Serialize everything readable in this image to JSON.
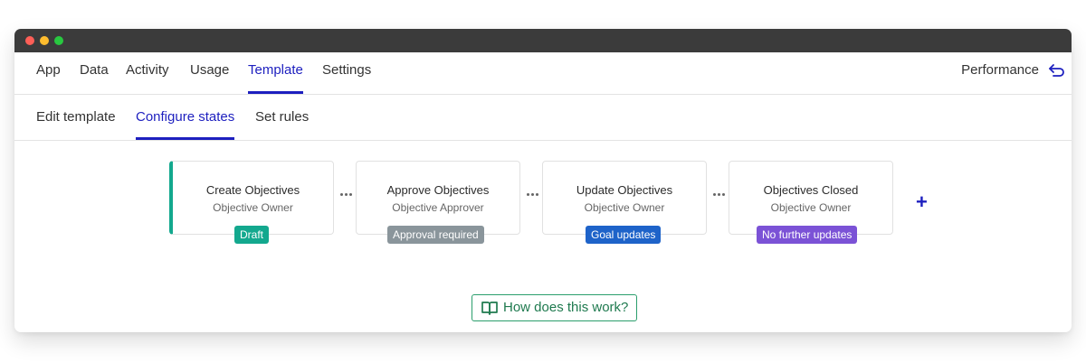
{
  "top_nav": {
    "tabs": [
      {
        "label": "App"
      },
      {
        "label": "Data"
      },
      {
        "label": "Activity"
      },
      {
        "label": "Usage"
      },
      {
        "label": "Template",
        "active": true
      },
      {
        "label": "Settings"
      }
    ],
    "right_label": "Performance",
    "right_icon": "return-arrow-icon"
  },
  "sub_nav": {
    "tabs": [
      {
        "label": "Edit template"
      },
      {
        "label": "Configure states",
        "active": true
      },
      {
        "label": "Set rules"
      }
    ]
  },
  "states": [
    {
      "title": "Create Objectives",
      "owner": "Objective Owner",
      "badge": "Draft",
      "badge_color": "#13a88e"
    },
    {
      "title": "Approve Objectives",
      "owner": "Objective Approver",
      "badge": "Approval required",
      "badge_color": "#8a959b"
    },
    {
      "title": "Update Objectives",
      "owner": "Objective Owner",
      "badge": "Goal updates",
      "badge_color": "#1e63c9"
    },
    {
      "title": "Objectives Closed",
      "owner": "Objective Owner",
      "badge": "No further updates",
      "badge_color": "#7b52d6"
    }
  ],
  "add_state_icon": "plus-icon",
  "help_button": {
    "label": "How does this work?",
    "icon": "book-icon"
  },
  "colors": {
    "accent": "#1d1fbf",
    "help_green": "#1f7a4f"
  }
}
